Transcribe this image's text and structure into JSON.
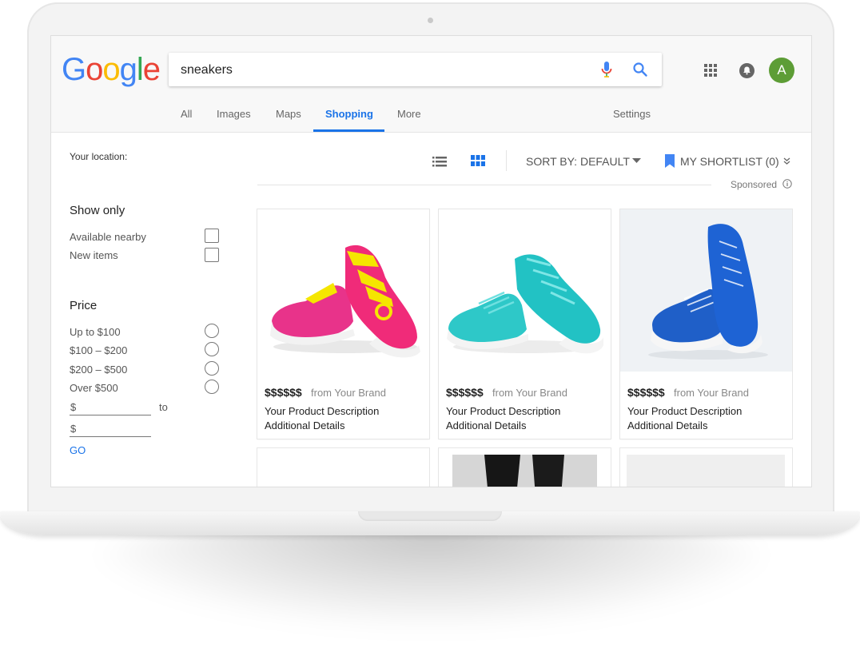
{
  "search": {
    "query": "sneakers"
  },
  "logo": {
    "letters": [
      "G",
      "o",
      "o",
      "g",
      "l",
      "e"
    ],
    "colors": [
      "#4285F4",
      "#EA4335",
      "#FBBC05",
      "#4285F4",
      "#34A853",
      "#EA4335"
    ]
  },
  "header": {
    "avatar_letter": "A",
    "avatar_color": "#5d9d36"
  },
  "tabs": [
    {
      "label": "All"
    },
    {
      "label": "Images"
    },
    {
      "label": "Maps"
    },
    {
      "label": "Shopping",
      "active": true
    },
    {
      "label": "More"
    }
  ],
  "settings_label": "Settings",
  "sidebar": {
    "location_label": "Your location:",
    "show_only": {
      "title": "Show only",
      "options": [
        "Available nearby",
        "New items"
      ]
    },
    "price": {
      "title": "Price",
      "options": [
        "Up to $100",
        "$100 – $200",
        "$200 – $500",
        "Over $500"
      ],
      "min_prefix": "$",
      "max_prefix": "$",
      "to_label": "to",
      "go_label": "GO"
    }
  },
  "toolbar": {
    "sort_label": "SORT BY: DEFAULT",
    "shortlist_label": "MY SHORTLIST (0)",
    "sponsored_label": "Sponsored"
  },
  "products": [
    {
      "price": "$$$$$$",
      "brand": "from Your Brand",
      "description": "Your Product Description",
      "details": "Additional Details",
      "shoe_color": "#e8338a",
      "lace_color": "#f5e600",
      "bg": "#ffffff"
    },
    {
      "price": "$$$$$$",
      "brand": "from Your Brand",
      "description": "Your Product Description",
      "details": "Additional Details",
      "shoe_color": "#2ec8c8",
      "lace_color": "#2ec8c8",
      "bg": "#ffffff"
    },
    {
      "price": "$$$$$$",
      "brand": "from Your Brand",
      "description": "Your Product Description",
      "details": "Additional Details",
      "shoe_color": "#1f5fc8",
      "lace_color": "#1f5fc8",
      "bg": "#eff2f5"
    }
  ],
  "colors": {
    "accent": "#1a73e8",
    "shortlist_icon": "#4285F4"
  }
}
